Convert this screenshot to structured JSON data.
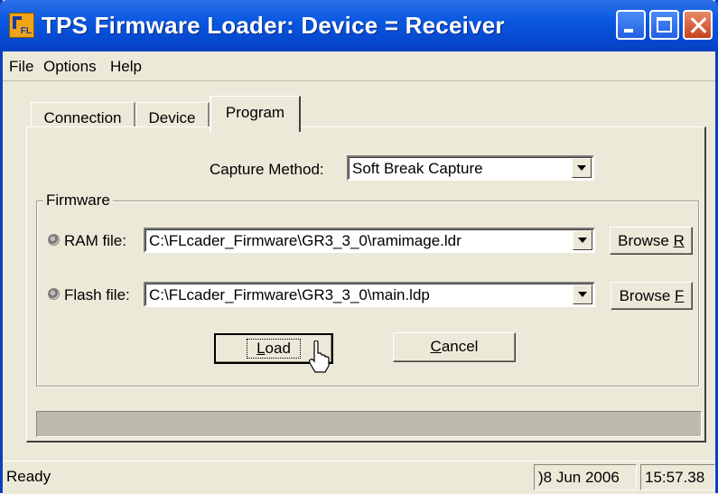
{
  "window": {
    "title": "TPS Firmware Loader:  Device = Receiver",
    "app_icon_label": "FL"
  },
  "menu": {
    "items": [
      "File",
      "Options",
      "Help"
    ]
  },
  "tabs": {
    "items": [
      {
        "label": "Connection",
        "active": false
      },
      {
        "label": "Device",
        "active": false
      },
      {
        "label": "Program",
        "active": true
      }
    ]
  },
  "capture": {
    "label": "Capture Method:",
    "value": "Soft Break Capture"
  },
  "firmware": {
    "group_label": "Firmware",
    "ram": {
      "label": "RAM file:",
      "value": "C:\\FLcader_Firmware\\GR3_3_0\\ramimage.ldr",
      "browse_label": "Browse ",
      "browse_mnemonic": "R"
    },
    "flash": {
      "label": "Flash file:",
      "value": "C:\\FLcader_Firmware\\GR3_3_0\\main.ldp",
      "browse_label": "Browse ",
      "browse_mnemonic": "F"
    }
  },
  "actions": {
    "load_mnemonic": "L",
    "load_rest": "oad",
    "cancel_mnemonic": "C",
    "cancel_rest": "ancel"
  },
  "progress": {
    "value": 0
  },
  "status": {
    "text": "Ready",
    "date": ")8 Jun 2006",
    "time": "15:57.38"
  },
  "colors": {
    "titlebar": "#0a58e0",
    "window_bg": "#ece9d8",
    "close_button": "#c8421c",
    "progress_track": "#bdbaae"
  }
}
